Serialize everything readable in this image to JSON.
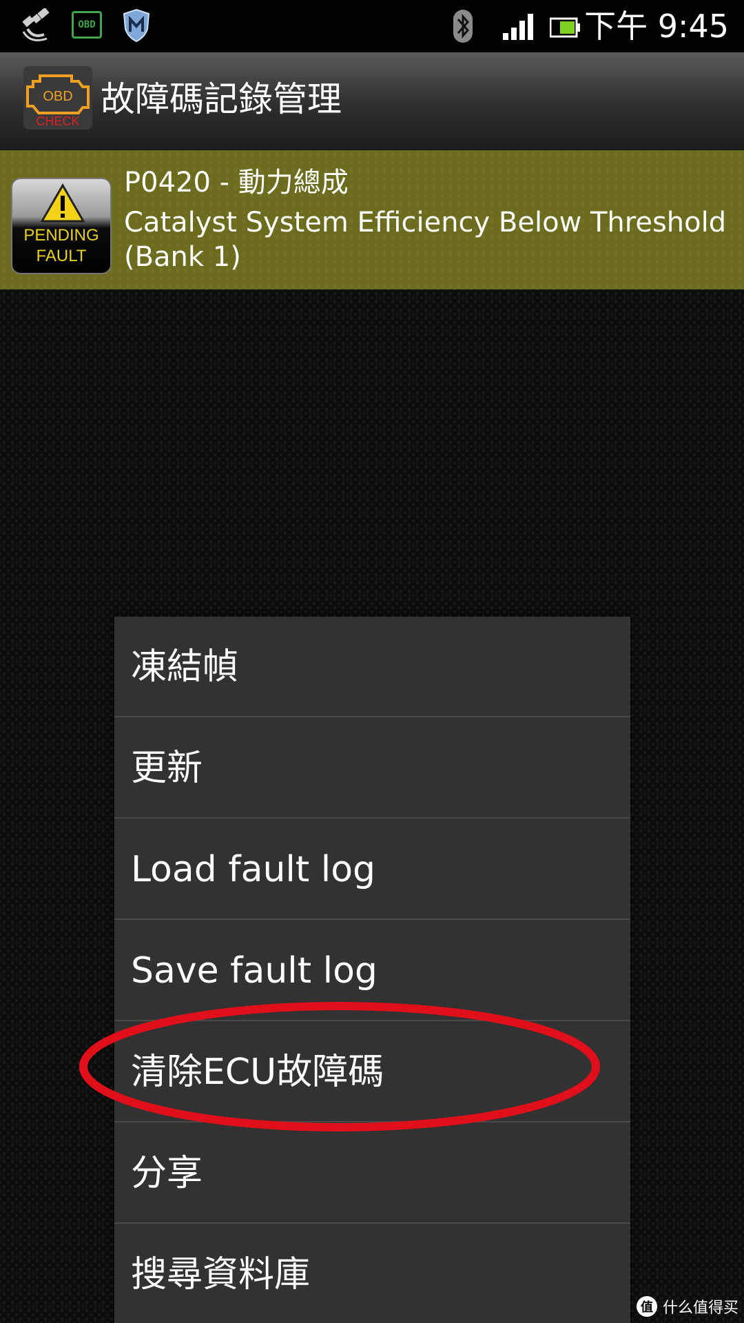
{
  "status_bar": {
    "time": "下午 9:45",
    "obd_icon_label": "OBD",
    "icons": [
      "gps-icon",
      "obd-icon",
      "shield-icon",
      "bluetooth-icon",
      "signal-icon",
      "battery-icon"
    ]
  },
  "title_bar": {
    "icon_obd": "OBD",
    "icon_check": "CHECK",
    "title": "故障碼記錄管理"
  },
  "fault": {
    "badge_line1": "PENDING",
    "badge_line2": "FAULT",
    "code": "P0420 - 動力總成",
    "description_line1": "Catalyst System Efficiency Below Threshold",
    "description_line2": "(Bank 1)",
    "row_color": "#6b6c1d"
  },
  "menu": {
    "items": [
      {
        "label": "凍結幀"
      },
      {
        "label": "更新"
      },
      {
        "label": "Load fault log"
      },
      {
        "label": "Save fault log"
      },
      {
        "label": "清除ECU故障碼"
      },
      {
        "label": "分享"
      },
      {
        "label": "搜尋資料庫"
      }
    ],
    "highlight_color": "#e0101a"
  },
  "watermark": {
    "logo": "值",
    "text": "什么值得买"
  }
}
